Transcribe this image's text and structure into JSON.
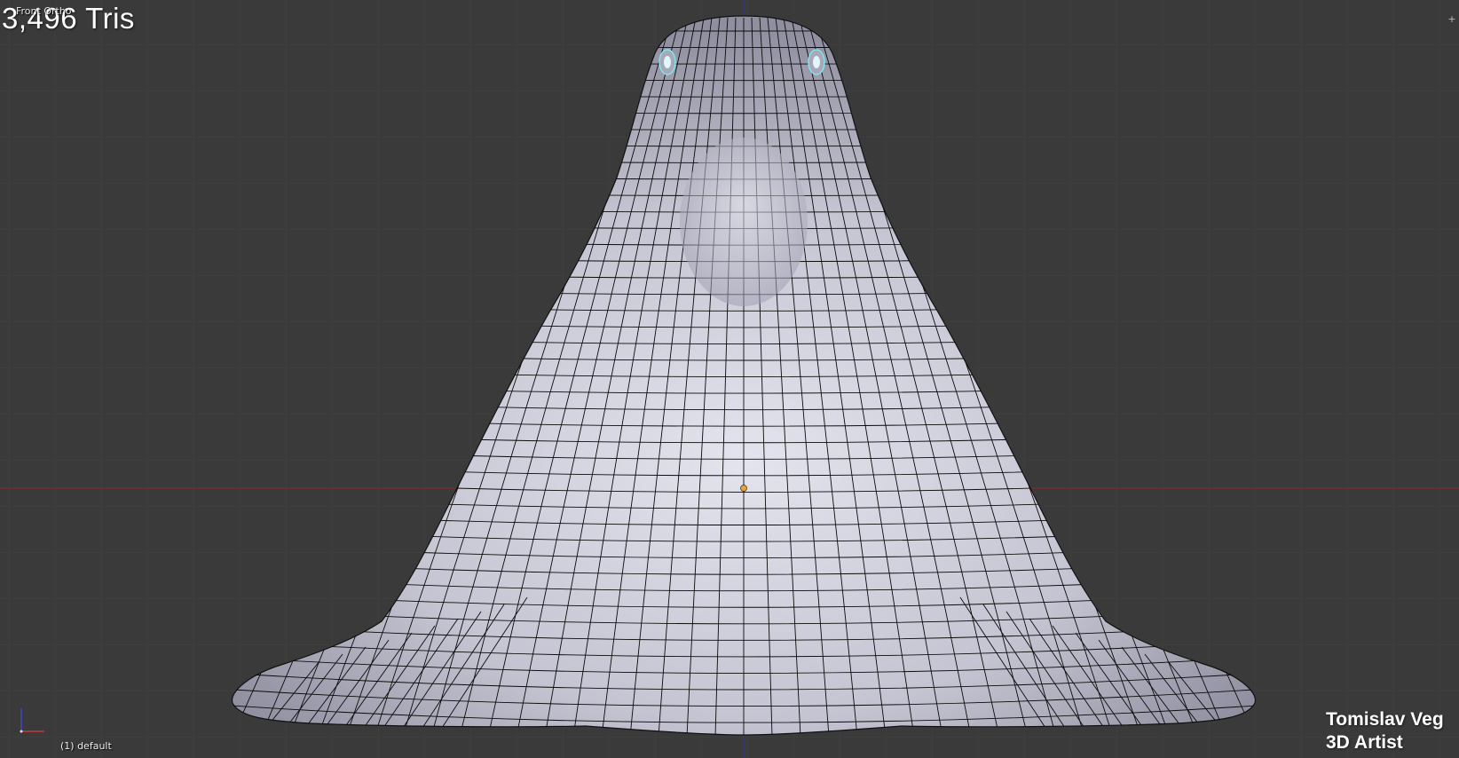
{
  "viewport": {
    "view_name": "Front Ortho",
    "tris_count": "3,496 Tris",
    "object_name": "(1) default",
    "credit_name": "Tomislav Veg",
    "credit_role": "3D Artist",
    "corner_widget_icon": "plus-icon",
    "colors": {
      "background": "#3a3a3a",
      "grid": "#444444",
      "x_axis": "#8a2f2f",
      "z_axis": "#2f3f8a",
      "mesh_fill": "#c9c9d6",
      "wire": "#000000",
      "origin": "#f0a030",
      "eye_highlight": "#7fe6ee"
    }
  }
}
